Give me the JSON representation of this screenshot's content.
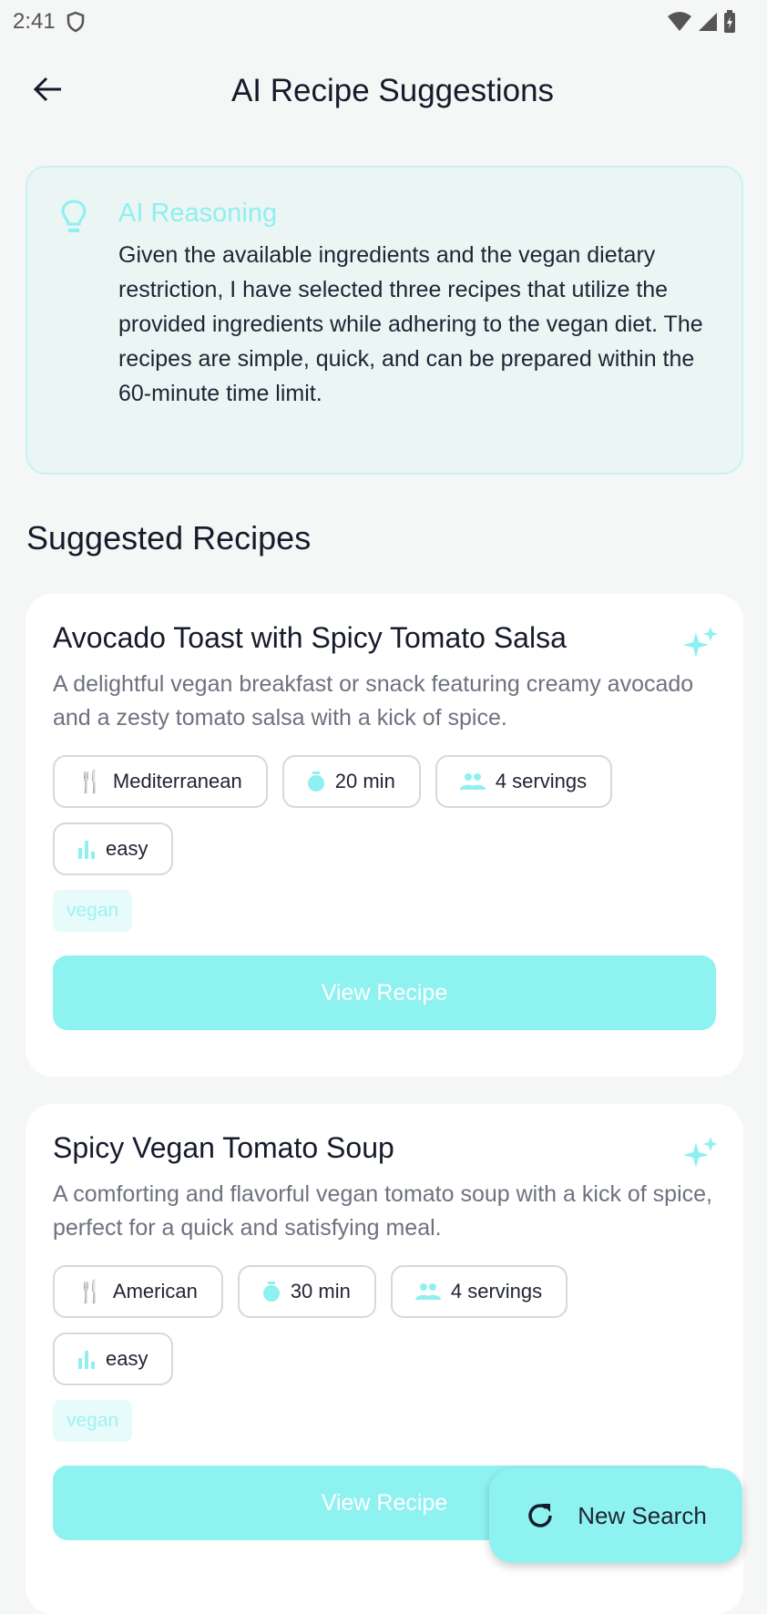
{
  "status_bar": {
    "time": "2:41"
  },
  "header": {
    "title": "AI Recipe Suggestions"
  },
  "reasoning": {
    "title": "AI Reasoning",
    "text": "Given the available ingredients and the vegan dietary restriction, I have selected three recipes that utilize the provided ingredients while adhering to the vegan diet. The recipes are simple, quick, and can be prepared within the 60-minute time limit."
  },
  "section_title": "Suggested Recipes",
  "recipes": [
    {
      "title": "Avocado Toast with Spicy Tomato Salsa",
      "description": "A delightful vegan breakfast or snack featuring creamy avocado and a zesty tomato salsa with a kick of spice.",
      "cuisine": "Mediterranean",
      "time": "20 min",
      "servings": "4 servings",
      "difficulty": "easy",
      "tag": "vegan",
      "button": "View Recipe"
    },
    {
      "title": "Spicy Vegan Tomato Soup",
      "description": "A comforting and flavorful vegan tomato soup with a kick of spice, perfect for a quick and satisfying meal.",
      "cuisine": "American",
      "time": "30 min",
      "servings": "4 servings",
      "difficulty": "easy",
      "tag": "vegan",
      "button": "View Recipe"
    }
  ],
  "fab": {
    "label": "New Search"
  },
  "colors": {
    "accent": "#8ef2f1",
    "text": "#161b2b",
    "muted": "#6e7280"
  }
}
